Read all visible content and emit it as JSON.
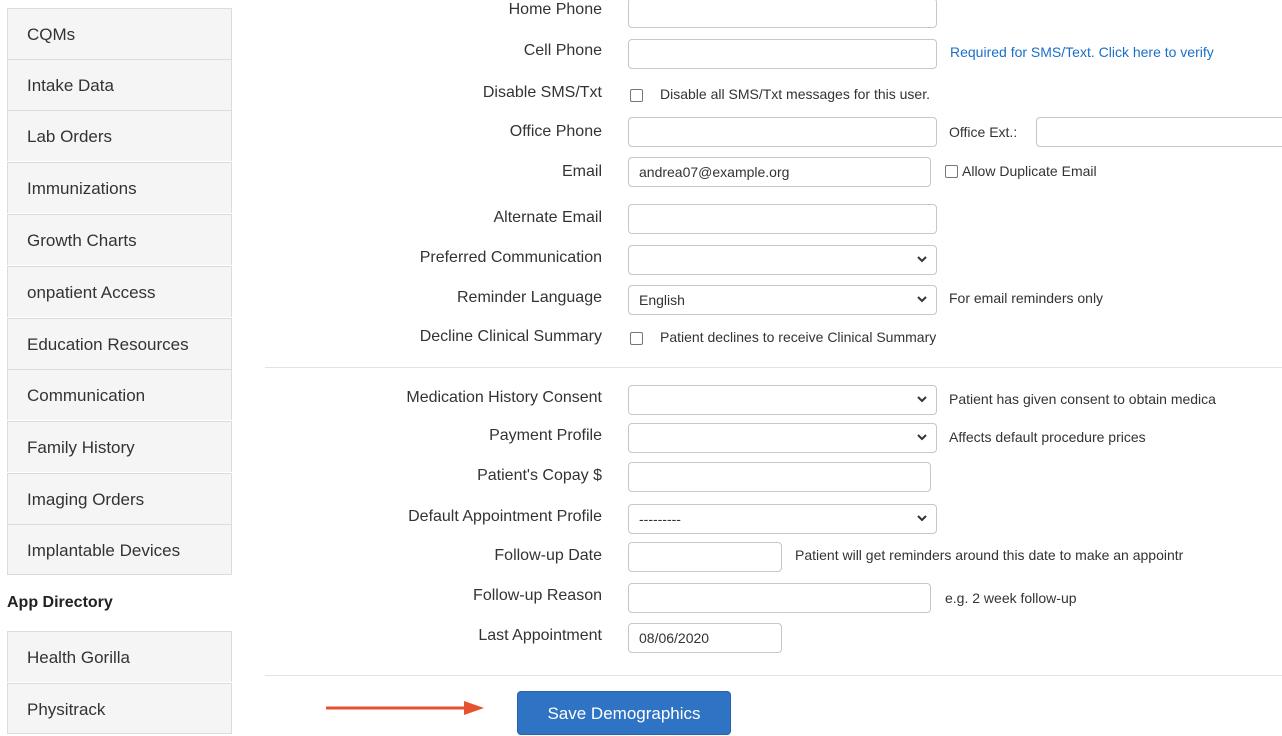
{
  "sidebar": {
    "items": [
      "CQMs",
      "Intake Data",
      "Lab Orders",
      "Immunizations",
      "Growth Charts",
      "onpatient Access",
      "Education Resources",
      "Communication",
      "Family History",
      "Imaging Orders",
      "Implantable Devices"
    ],
    "app_directory": {
      "heading": "App Directory",
      "items": [
        "Health Gorilla",
        "Physitrack"
      ]
    }
  },
  "form": {
    "home_phone": {
      "label": "Home Phone",
      "value": ""
    },
    "cell_phone": {
      "label": "Cell Phone",
      "value": "",
      "help": "Required for SMS/Text. Click here to verify"
    },
    "disable_sms": {
      "label": "Disable SMS/Txt",
      "checkbox_text": "Disable all SMS/Txt messages for this user.",
      "checked": false
    },
    "office_phone": {
      "label": "Office Phone",
      "value": "",
      "ext_label": "Office Ext.:",
      "ext_value": ""
    },
    "email": {
      "label": "Email",
      "value": "andrea07@example.org",
      "dup_text": "Allow Duplicate Email",
      "dup_checked": false
    },
    "alternate_email": {
      "label": "Alternate Email",
      "value": ""
    },
    "preferred_communication": {
      "label": "Preferred Communication",
      "value": ""
    },
    "reminder_language": {
      "label": "Reminder Language",
      "value": "English",
      "help": "For email reminders only"
    },
    "decline_summary": {
      "label": "Decline Clinical Summary",
      "checkbox_text": "Patient declines to receive Clinical Summary",
      "checked": false
    },
    "medication_consent": {
      "label": "Medication History Consent",
      "value": "",
      "help": "Patient has given consent to obtain medica"
    },
    "payment_profile": {
      "label": "Payment Profile",
      "value": "",
      "help": "Affects default procedure prices"
    },
    "copay": {
      "label": "Patient's Copay $",
      "value": ""
    },
    "default_appt_profile": {
      "label": "Default Appointment Profile",
      "value": "---------"
    },
    "followup_date": {
      "label": "Follow-up Date",
      "value": "",
      "help": "Patient will get reminders around this date to make an appointr"
    },
    "followup_reason": {
      "label": "Follow-up Reason",
      "value": "",
      "help": "e.g. 2 week follow-up"
    },
    "last_appointment": {
      "label": "Last Appointment",
      "value": "08/06/2020"
    }
  },
  "actions": {
    "save_label": "Save Demographics"
  },
  "colors": {
    "primary_button": "#2f73c4",
    "link": "#1a6fc9",
    "arrow": "#e8502f"
  }
}
